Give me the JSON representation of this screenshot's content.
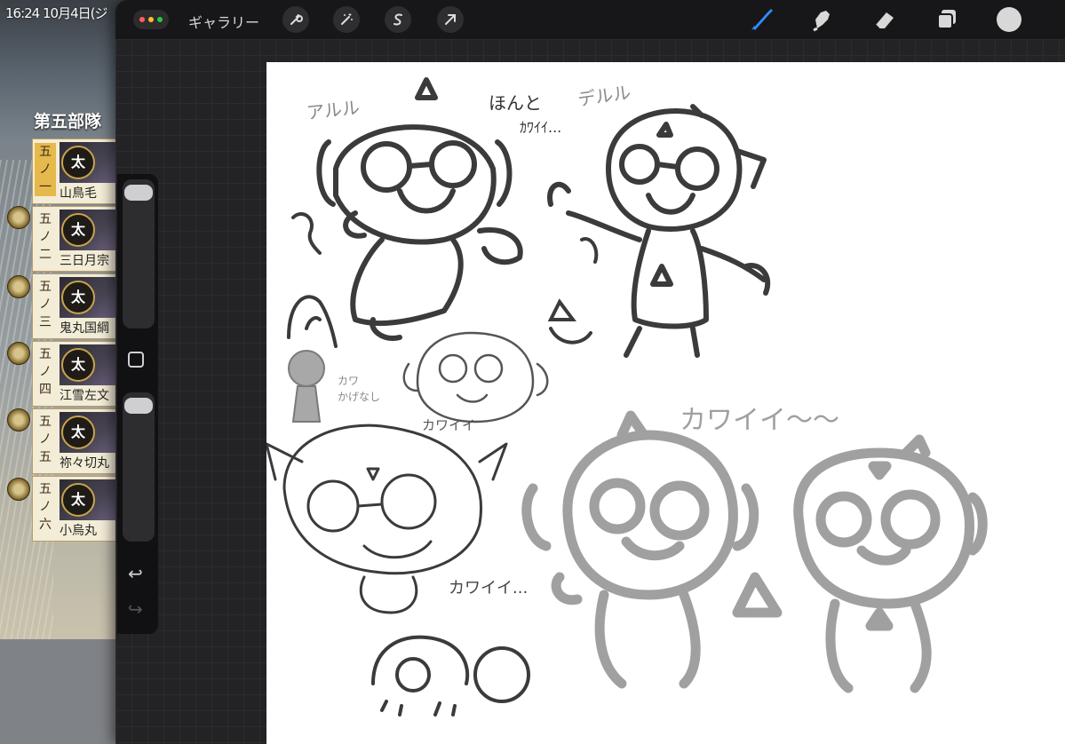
{
  "status_time": "16:24 10月4日(ジ",
  "game": {
    "unit_title": "第五部隊",
    "units": [
      {
        "slot": "五ノ一",
        "emblem": "太",
        "name": "山鳥毛"
      },
      {
        "slot": "五ノ二",
        "emblem": "太",
        "name": "三日月宗"
      },
      {
        "slot": "五ノ三",
        "emblem": "太",
        "name": "鬼丸国綱"
      },
      {
        "slot": "五ノ四",
        "emblem": "太",
        "name": "江雪左文"
      },
      {
        "slot": "五ノ五",
        "emblem": "太",
        "name": "祢々切丸"
      },
      {
        "slot": "五ノ六",
        "emblem": "太",
        "name": "小烏丸"
      }
    ]
  },
  "app": {
    "gallery_label": "ギャラリー",
    "left_tools": [
      "wrench-icon",
      "magic-wand-icon",
      "selection-icon",
      "transform-arrow-icon"
    ],
    "right_tools": [
      "brush-icon",
      "smudge-icon",
      "eraser-icon",
      "layers-icon",
      "color-picker"
    ],
    "accent_color": "#2f8cff",
    "color_swatch": "#d8d8d8"
  },
  "sketch_text": {
    "label_1": "アルル",
    "label_2": "ほんと",
    "label_2b": "ｶﾜｲｲ...",
    "label_3": "デルル",
    "label_4": "カワイイ",
    "label_5": "カワイイ...",
    "label_6": "カワイイ〜〜",
    "label_7": "カワ",
    "label_7b": "かげなし"
  }
}
